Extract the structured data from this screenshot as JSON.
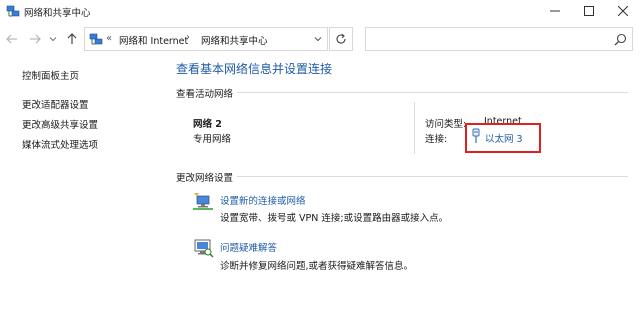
{
  "window": {
    "title": "网络和共享中心"
  },
  "address_bar": {
    "overflow_glyph": "«",
    "crumbs": [
      "网络和 Internet",
      "网络和共享中心"
    ],
    "separator": "›",
    "search_placeholder": ""
  },
  "left_pane": {
    "links": [
      "控制面板主页",
      "更改适配器设置",
      "更改高级共享设置",
      "媒体流式处理选项"
    ]
  },
  "main": {
    "title": "查看基本网络信息并设置连接",
    "active_networks": {
      "heading": "查看活动网络",
      "network_name": "网络 2",
      "network_type": "专用网络",
      "access_type_label": "访问类型:",
      "access_type_value": "Internet",
      "connections_label": "连接:",
      "connection_name": "以太网 3"
    },
    "change_settings": {
      "heading": "更改网络设置",
      "tasks": [
        {
          "link": "设置新的连接或网络",
          "description": "设置宽带、拨号或 VPN 连接;或设置路由器或接入点。",
          "icon": "new-connection-icon"
        },
        {
          "link": "问题疑难解答",
          "description": "诊断并修复网络问题,或者获得疑难解答信息。",
          "icon": "troubleshoot-icon"
        }
      ]
    }
  },
  "colors": {
    "link_blue": "#1e5aa8",
    "highlight_red": "#e02020"
  }
}
